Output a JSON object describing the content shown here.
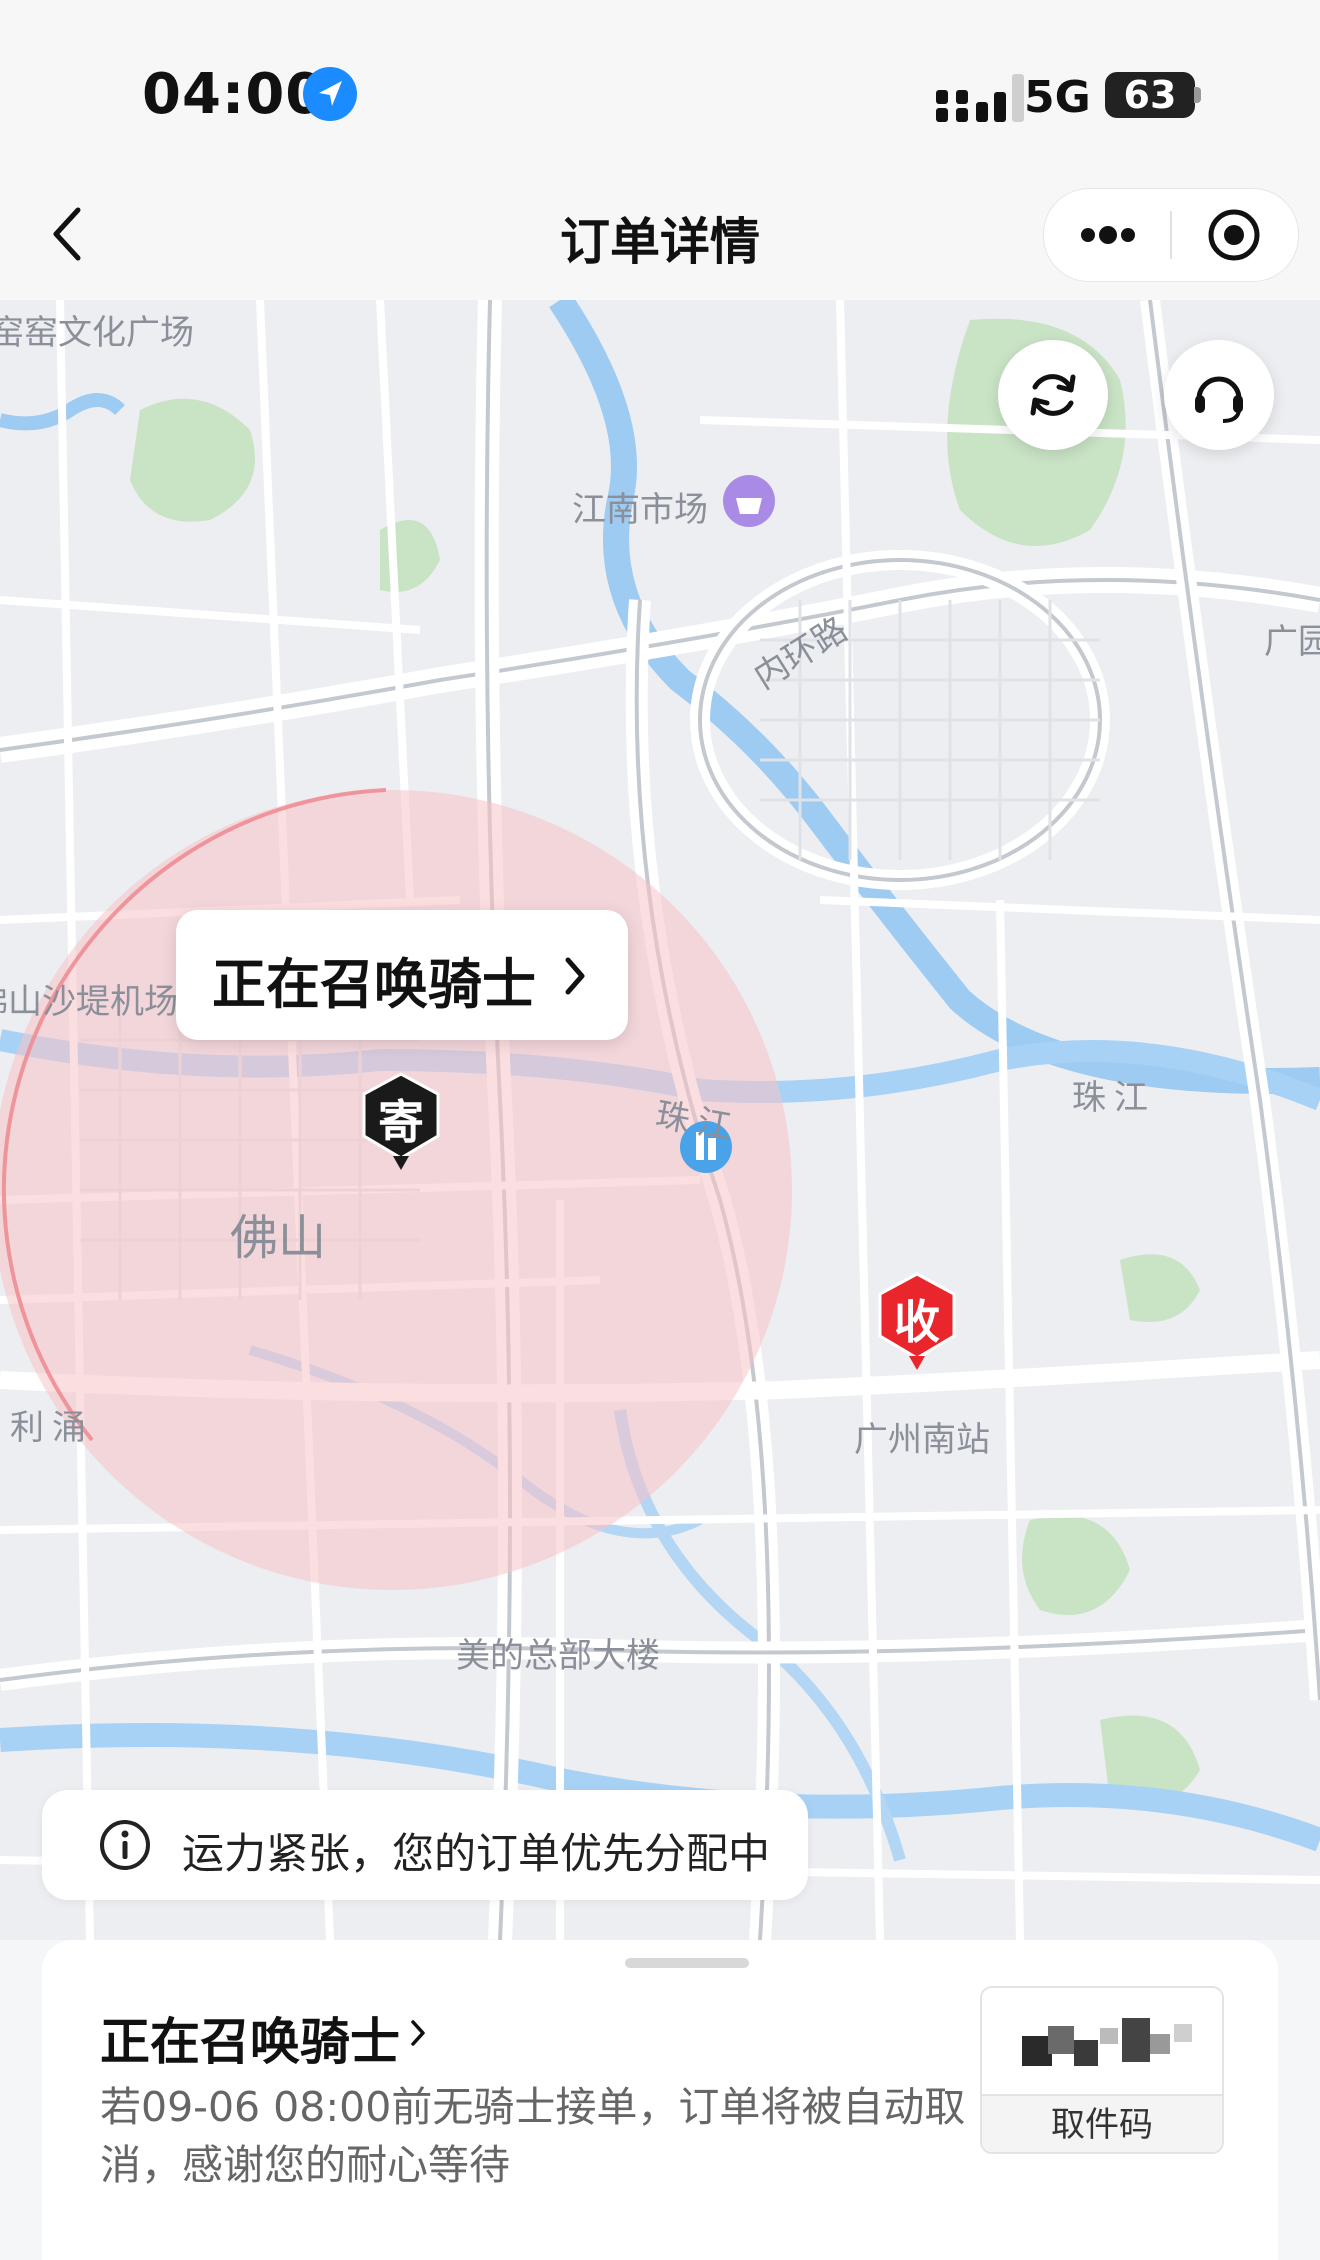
{
  "status_bar": {
    "time": "04:00",
    "network": "5G",
    "battery": "63"
  },
  "nav": {
    "title": "订单详情"
  },
  "map": {
    "labels": {
      "kiln": "窑窑文化广场",
      "jiangnan": "江南市场",
      "inner_ring": "内环路",
      "guang": "广园",
      "airport": "佛山沙堤机场",
      "zhujiang1": "珠江",
      "zhujiang2": "珠江",
      "foshan": "佛山",
      "liyong": "利涌",
      "south_station": "广州南站",
      "midea": "美的总部大楼"
    },
    "bubble": "正在召唤骑士",
    "sender_pin": "寄",
    "receiver_pin": "收",
    "notice": "运力紧张，您的订单优先分配中"
  },
  "card": {
    "title": "正在召唤骑士",
    "description": "若09-06 08:00前无骑士接单，订单将被自动取消，感谢您的耐心等待",
    "pickup_code_label": "取件码"
  },
  "colors": {
    "brand_blue": "#1a8cff",
    "receiver_red": "#e8262b",
    "radius_pink": "#f3a0a4"
  }
}
